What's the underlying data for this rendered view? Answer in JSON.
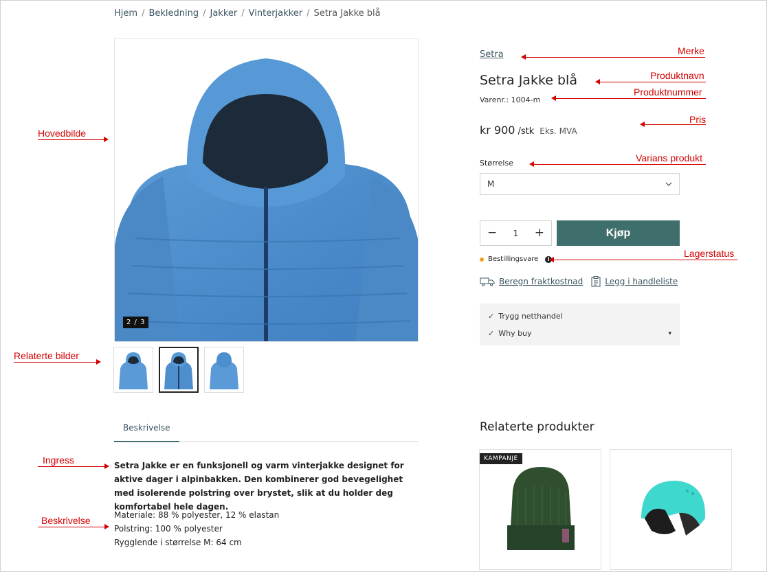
{
  "breadcrumb": [
    {
      "label": "Hjem"
    },
    {
      "label": "Bekledning"
    },
    {
      "label": "Jakker"
    },
    {
      "label": "Vinterjakker"
    },
    {
      "label": "Setra Jakke blå"
    }
  ],
  "gallery": {
    "counter": "2 / 3",
    "thumbnails": [
      "front",
      "front-active",
      "back"
    ]
  },
  "product": {
    "brand": "Setra",
    "name": "Setra Jakke blå",
    "sku": "Varenr.: 1004-m",
    "price": "kr 900",
    "price_unit": "/stk",
    "price_vat": "Eks. MVA",
    "variant_label": "Størrelse",
    "variant_value": "M",
    "quantity": "1",
    "buy_label": "Kjøp",
    "stock_status": "Bestillingsvare",
    "freight_link": "Beregn fraktkostnad",
    "list_link": "Legg i handleliste",
    "trust": [
      {
        "label": "Trygg netthandel"
      },
      {
        "label": "Why buy"
      }
    ]
  },
  "description": {
    "tab_label": "Beskrivelse",
    "ingress": "Setra Jakke er en funksjonell og varm vinterjakke designet for aktive dager i alpinbakken. Den kombinerer god bevegelighet med isolerende polstring over brystet, slik at du holder deg komfortabel hele dagen.",
    "lines": [
      "Materiale: 88 % polyester, 12 % elastan",
      "Polstring: 100 % polyester",
      "Rygglende i størrelse M: 64 cm"
    ]
  },
  "related": {
    "title": "Relaterte produkter",
    "badge": "KAMPANJE"
  },
  "annotations": {
    "merke": "Merke",
    "produktnavn": "Produktnavn",
    "produktnummer": "Produktnummer",
    "pris": "Pris",
    "varians": "Varians produkt",
    "lagerstatus": "Lagerstatus",
    "hovedbilde": "Hovedbilde",
    "relaterte_bilder": "Relaterte bilder",
    "ingress": "Ingress",
    "beskrivelse": "Beskrivelse"
  },
  "colors": {
    "accent": "#3f6f6c",
    "link": "#3b5560",
    "annotation": "#d40000",
    "stock_dot": "#f0a020",
    "jacket": "#4d8fcc"
  }
}
